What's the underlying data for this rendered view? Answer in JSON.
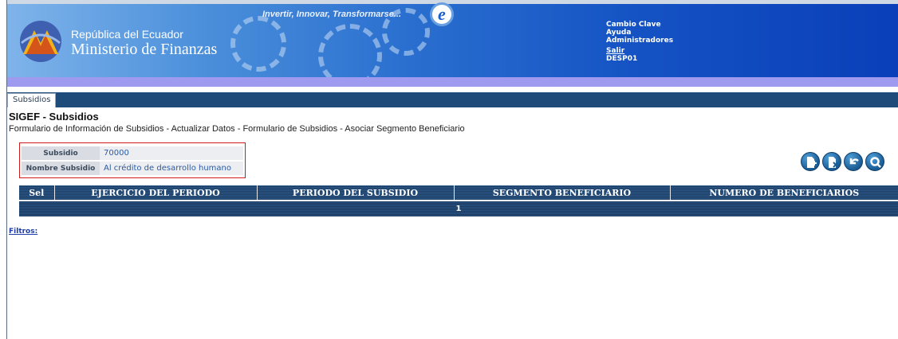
{
  "header": {
    "brand_small": "República del Ecuador",
    "brand_big": "Ministerio de Finanzas",
    "slogan": "Invertir, Innovar, Transformarse...",
    "logo_icon": "ministry-logo-icon",
    "user_menu": {
      "cambio_clave": "Cambio Clave",
      "ayuda": "Ayuda",
      "administradores": "Administradores",
      "salir": "Salir",
      "user": "DESP01"
    }
  },
  "tabs": [
    {
      "label": "Subsidios",
      "active": true
    }
  ],
  "page": {
    "title": "SIGEF - Subsidios",
    "breadcrumb": "Formulario de Información de Subsidios - Actualizar Datos - Formulario de Subsidios - Asociar Segmento Beneficiario"
  },
  "info": {
    "subsidio_label": "Subsidio",
    "subsidio_value": "70000",
    "nombre_label": "Nombre Subsidio",
    "nombre_value": "Al crédito de desarrollo humano"
  },
  "actions": [
    {
      "name": "add-record-button",
      "icon": "document-add-icon"
    },
    {
      "name": "delete-record-button",
      "icon": "document-delete-icon"
    },
    {
      "name": "back-button",
      "icon": "back-arrow-icon"
    },
    {
      "name": "search-button",
      "icon": "magnifier-icon"
    }
  ],
  "grid": {
    "columns": [
      "Sel",
      "EJERCICIO DEL PERIODO",
      "PERIODO DEL SUBSIDIO",
      "SEGMENTO BENEFICIARIO",
      "NUMERO DE BENEFICIARIOS"
    ],
    "page_number": "1"
  },
  "filtros_label": "Filtros:",
  "colors": {
    "header_blue": "#1553c4",
    "lilac_bar": "#9d9af0",
    "tabbar": "#1e4b7a",
    "grid_header": "#1d3f66",
    "infobox_border": "#d11a1a",
    "link": "#1f3fa8"
  }
}
